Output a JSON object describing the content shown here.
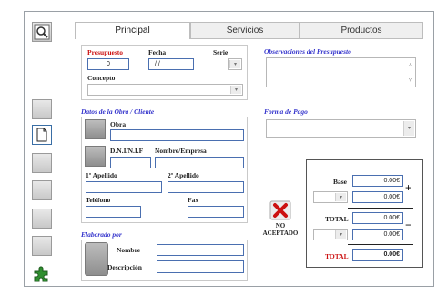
{
  "tabs": [
    {
      "label": "Principal",
      "active": true
    },
    {
      "label": "Servicios",
      "active": false
    },
    {
      "label": "Productos",
      "active": false
    }
  ],
  "presupuesto": {
    "label_presupuesto": "Presupuesto",
    "label_fecha": "Fecha",
    "label_serie": "Serie",
    "label_concepto": "Concepto",
    "presupuesto_value": "0",
    "fecha_value": "/ /",
    "concepto_value": ""
  },
  "observaciones": {
    "title": "Observaciones del Presupuesto",
    "value": ""
  },
  "cliente": {
    "title": "Datos de la Obra / Cliente",
    "label_obra": "Obra",
    "label_nif": "D.N.I/N.I.F",
    "label_nombre_empresa": "Nombre/Empresa",
    "label_apellido1": "1º Apellido",
    "label_apellido2": "2º Apellido",
    "label_telefono": "Teléfono",
    "label_fax": "Fax"
  },
  "forma_pago": {
    "title": "Forma de Pago",
    "value": ""
  },
  "elaborado": {
    "title": "Elaborado por",
    "label_nombre": "Nombre",
    "label_descripcion": "Descripción"
  },
  "estado": {
    "text_line1": "NO",
    "text_line2": "ACEPTADO"
  },
  "totales": {
    "label_base": "Base",
    "base_value": "0.00€",
    "impuesto1_value": "0.00€",
    "label_total": "TOTAL",
    "total_value": "0.00€",
    "retencion_value": "0.00€",
    "label_total_final": "TOTAL",
    "total_final_value": "0.00€",
    "plus_sign": "+",
    "minus_sign": "−"
  },
  "colors": {
    "accent_blue": "#3333cc",
    "required_red": "#cc1111",
    "input_border": "#4a6fb0"
  },
  "icons": [
    "search-icon",
    "document-icon",
    "puzzle-icon",
    "reject-x-icon"
  ]
}
